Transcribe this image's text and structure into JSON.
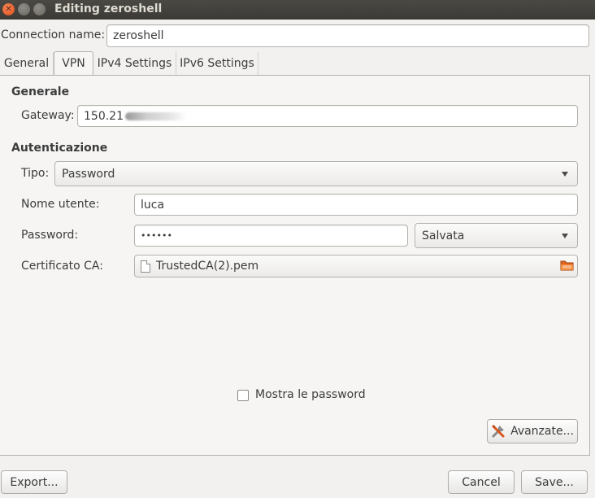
{
  "window": {
    "title": "Editing zeroshell",
    "close_glyph": "✕"
  },
  "connection": {
    "label": "Connection name:",
    "value": "zeroshell"
  },
  "tabs": [
    {
      "label": "General",
      "active": false
    },
    {
      "label": "VPN",
      "active": true
    },
    {
      "label": "IPv4 Settings",
      "active": false
    },
    {
      "label": "IPv6 Settings",
      "active": false
    }
  ],
  "vpn": {
    "generale_heading": "Generale",
    "gateway_label": "Gateway:",
    "gateway_value": "150.21",
    "auth_heading": "Autenticazione",
    "tipo_label": "Tipo:",
    "tipo_value": "Password",
    "username_label": "Nome utente:",
    "username_value": "luca",
    "password_label": "Password:",
    "password_value": "••••••",
    "password_storage": "Salvata",
    "ca_label": "Certificato CA:",
    "ca_value": "TrustedCA(2).pem",
    "show_passwords_label": "Mostra le password",
    "show_passwords_checked": false,
    "advanced_label": "Avanzate..."
  },
  "footer": {
    "export_label": "Export...",
    "cancel_label": "Cancel",
    "save_label": "Save..."
  },
  "colors": {
    "titlebar": "#3c3b37",
    "close_button": "#e5541d",
    "window_bg": "#f2f1f0",
    "folder_icon": "#e2651d"
  }
}
